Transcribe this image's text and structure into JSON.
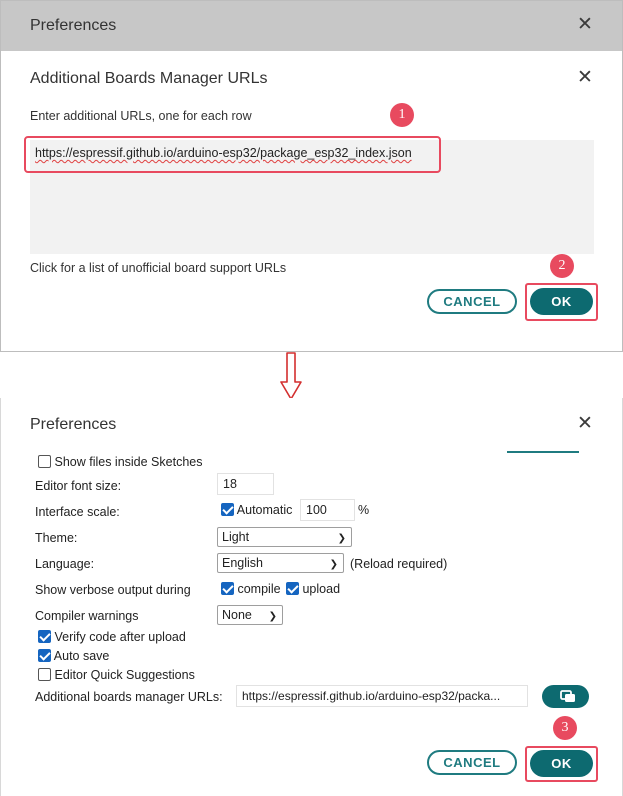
{
  "top_panel": {
    "background_window_title": "Preferences",
    "dialog": {
      "title": "Additional Boards Manager URLs",
      "instructions": "Enter additional URLs, one for each row",
      "url_value": "https://espressif.github.io/arduino-esp32/package_esp32_index.json",
      "unofficial_link": "Click for a list of unofficial board support URLs",
      "cancel_label": "CANCEL",
      "ok_label": "OK"
    },
    "annotations": [
      "1",
      "2"
    ]
  },
  "bottom_panel": {
    "title": "Preferences",
    "settings": {
      "show_files_label": "Show files inside Sketches",
      "font_size_label": "Editor font size:",
      "font_size_value": "18",
      "interface_scale_label": "Interface scale:",
      "automatic_label": "Automatic",
      "scale_value": "100",
      "scale_unit": "%",
      "theme_label": "Theme:",
      "theme_value": "Light",
      "language_label": "Language:",
      "language_value": "English",
      "reload_note": "(Reload required)",
      "verbose_label": "Show verbose output during",
      "compile_label": "compile",
      "upload_label": "upload",
      "compiler_warnings_label": "Compiler warnings",
      "compiler_warnings_value": "None",
      "verify_label": "Verify code after upload",
      "autosave_label": "Auto save",
      "quick_suggestions_label": "Editor Quick Suggestions",
      "boards_urls_label": "Additional boards manager URLs:",
      "boards_urls_value": "https://espressif.github.io/arduino-esp32/packa..."
    },
    "cancel_label": "CANCEL",
    "ok_label": "OK",
    "annotations": [
      "3"
    ]
  },
  "checkbox_states": {
    "show_files": false,
    "automatic": true,
    "compile": true,
    "upload": true,
    "verify": true,
    "autosave": true,
    "quick_suggestions": false
  },
  "colors": {
    "accent": "#0d6a70",
    "highlight": "#e84a5f",
    "checkbox": "#1565c0"
  },
  "icons": {
    "close": "close-icon",
    "open_urls": "open-window-icon",
    "arrow": "down-arrow-icon"
  }
}
